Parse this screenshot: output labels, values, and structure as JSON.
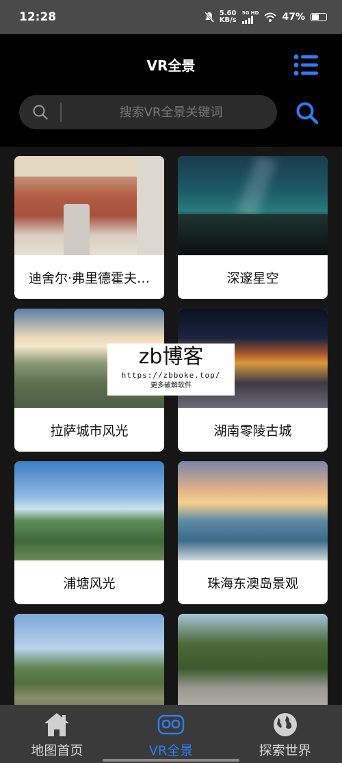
{
  "status_bar": {
    "time": "12:28",
    "net_speed_value": "5.60",
    "net_speed_unit": "KB/s",
    "net_type": "5G HD",
    "battery_percent": "47%"
  },
  "header": {
    "title": "VR全景",
    "menu_icon": "list-menu-icon",
    "search_placeholder": "搜索VR全景关键词",
    "search_icon": "search-icon"
  },
  "cards": [
    {
      "title": "迪舍尔·弗里德霍夫…"
    },
    {
      "title": "深邃星空"
    },
    {
      "title": "拉萨城市风光"
    },
    {
      "title": "湖南零陵古城"
    },
    {
      "title": "浦塘风光"
    },
    {
      "title": "珠海东澳岛景观"
    },
    {
      "title": ""
    },
    {
      "title": ""
    }
  ],
  "watermark": {
    "brand": "zb博客",
    "url": "https://zbboke.top/",
    "note": "更多破解软件"
  },
  "bottom_nav": {
    "items": [
      {
        "label": "地图首页",
        "icon": "home-icon"
      },
      {
        "label": "VR全景",
        "icon": "vr-headset-icon",
        "active": true
      },
      {
        "label": "探索世界",
        "icon": "globe-icon"
      }
    ]
  },
  "colors": {
    "accent": "#2f7cf6",
    "background": "#161616",
    "header_bg": "#000000",
    "nav_bg": "#3a3a3a"
  }
}
